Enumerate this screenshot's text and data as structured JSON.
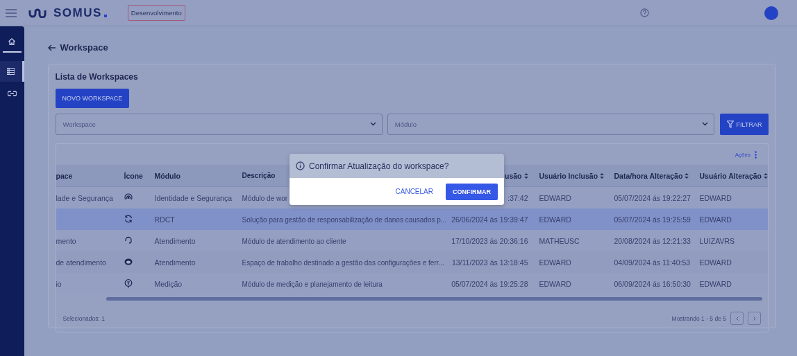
{
  "header": {
    "brand": "SOMUS",
    "environment": "Desenvolvimento"
  },
  "sidebar": {
    "items": [
      {
        "kind": "home",
        "selected": false
      },
      {
        "kind": "list",
        "selected": true
      },
      {
        "kind": "link",
        "selected": false
      }
    ]
  },
  "page": {
    "title": "Workspace"
  },
  "card": {
    "title": "Lista de Workspaces",
    "new_button": "NOVO WORKSPACE",
    "filters": [
      {
        "placeholder": "Workspace"
      },
      {
        "placeholder": "Módulo"
      }
    ],
    "filter_button": "FILTRAR"
  },
  "table": {
    "actions": "Ações",
    "columns": [
      {
        "label": "pace",
        "sortable": false
      },
      {
        "label": "Ícone",
        "sortable": false
      },
      {
        "label": "Módulo",
        "sortable": false
      },
      {
        "label": "Descrição",
        "sortable": false
      },
      {
        "label": "usão",
        "sortable": true
      },
      {
        "label": "Usuário Inclusão",
        "sortable": true
      },
      {
        "label": "Data/hora Alteração",
        "sortable": true
      },
      {
        "label": "Usuário Alteração",
        "sortable": true
      }
    ],
    "rows": [
      {
        "selected": false,
        "cells": [
          "lade e Segurança",
          "",
          "Identidade e Segurança",
          "Módulo de wor",
          ":37:42",
          "EDWARD",
          "05/07/2024 ás 19:22:27",
          "EDWARD"
        ]
      },
      {
        "selected": true,
        "cells": [
          "",
          "",
          "RDCT",
          "Solução para gestão de responsabilização de danos causados p...",
          "26/06/2024 ás 19:39:47",
          "EDWARD",
          "05/07/2024 ás 19:25:59",
          "EDWARD"
        ]
      },
      {
        "selected": false,
        "cells": [
          "mento",
          "",
          "Atendimento",
          "Módulo de atendimento ao cliente",
          "17/10/2023 ás 20:36:16",
          "MATHEUSC",
          "20/08/2024 ás 12:21:33",
          "LUIZAVRS"
        ]
      },
      {
        "selected": false,
        "cells": [
          "de atendimento",
          "",
          "Atendimento",
          "Espaço de trabalho destinado a gestão das configurações e ferr...",
          "13/11/2023 ás 13:18:45",
          "EDWARD",
          "04/09/2024 ás 11:40:53",
          "EDWARD"
        ]
      },
      {
        "selected": false,
        "cells": [
          "io",
          "",
          "Medição",
          "Módulo de medição e planejamento de leitura",
          "05/07/2024 ás 19:25:28",
          "EDWARD",
          "06/09/2024 ás 16:50:30",
          "EDWARD"
        ]
      }
    ],
    "selected_count": "Selecionados: 1",
    "pagination": "Mostrando 1 - 5 de 5"
  },
  "dialog": {
    "title": "Confirmar Atualização do workspace?",
    "cancel": "CANCELAR",
    "confirm": "CONFIRMAR"
  }
}
